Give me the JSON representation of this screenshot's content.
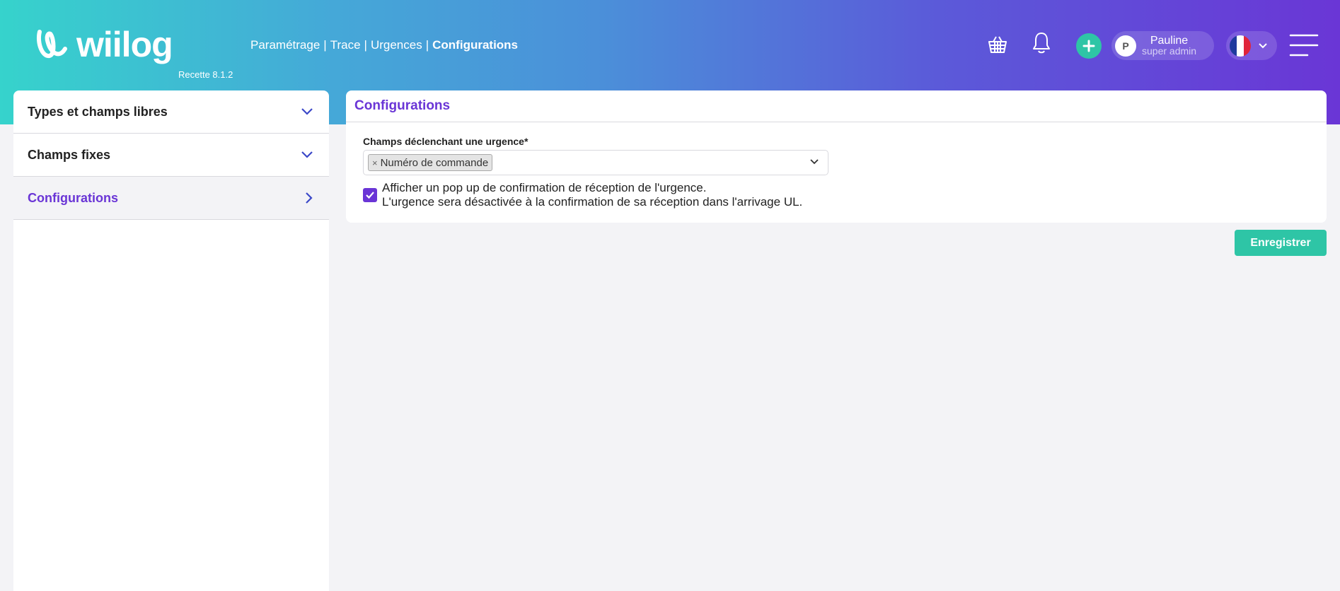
{
  "header": {
    "logo_text": "wiilog",
    "version": "Recette 8.1.2",
    "breadcrumb": [
      "Paramétrage",
      "Trace",
      "Urgences",
      "Configurations"
    ],
    "user": {
      "initial": "P",
      "name": "Pauline",
      "role": "super admin"
    },
    "icons": [
      "basket-icon",
      "bell-icon",
      "plus-icon",
      "flag-fr-icon",
      "chevron-down-icon",
      "menu-icon"
    ]
  },
  "sidebar": {
    "items": [
      {
        "label": "Types et champs libres",
        "icon": "chevron-down-icon"
      },
      {
        "label": "Champs fixes",
        "icon": "chevron-down-icon"
      },
      {
        "label": "Configurations",
        "icon": "chevron-right-icon",
        "active": true
      }
    ]
  },
  "panel": {
    "title": "Configurations",
    "field_label": "Champs déclenchant une urgence*",
    "selected_tag": "Numéro de commande",
    "tag_remove": "×",
    "checkbox_checked": true,
    "checkbox_line1": "Afficher un pop up de confirmation de réception de l'urgence.",
    "checkbox_line2": "L'urgence sera désactivée à la confirmation de sa réception dans l'arrivage UL."
  },
  "actions": {
    "save_label": "Enregistrer"
  },
  "colors": {
    "accent": "#6a35d6",
    "success": "#2ec5a6",
    "gradient_start": "#36d3cc",
    "gradient_end": "#6a36d6"
  }
}
